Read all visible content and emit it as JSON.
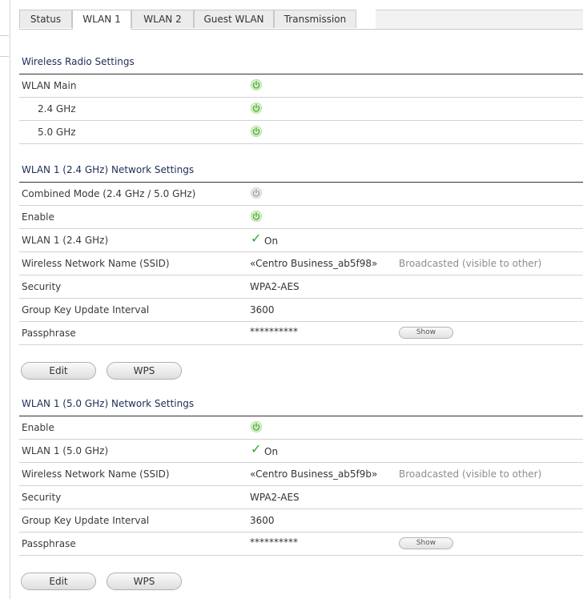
{
  "tabs": [
    {
      "label": "Status"
    },
    {
      "label": "WLAN 1"
    },
    {
      "label": "WLAN 2"
    },
    {
      "label": "Guest WLAN"
    },
    {
      "label": "Transmission"
    }
  ],
  "radio": {
    "title": "Wireless Radio Settings",
    "main": {
      "label": "WLAN Main",
      "state": "on"
    },
    "band24": {
      "label": "2.4 GHz",
      "state": "on"
    },
    "band50": {
      "label": "5.0 GHz",
      "state": "on"
    }
  },
  "wlan24": {
    "title": "WLAN 1 (2.4 GHz) Network Settings",
    "combined": {
      "label": "Combined Mode (2.4 GHz / 5.0 GHz)",
      "state": "off"
    },
    "enable": {
      "label": "Enable",
      "state": "on"
    },
    "status": {
      "label": "WLAN 1 (2.4 GHz)",
      "value": "On"
    },
    "ssid": {
      "label": "Wireless Network Name (SSID)",
      "value": "«Centro Business_ab5f98»",
      "note": "Broadcasted (visible to other)"
    },
    "security": {
      "label": "Security",
      "value": "WPA2-AES"
    },
    "interval": {
      "label": "Group Key Update Interval",
      "value": "3600"
    },
    "passphrase": {
      "label": "Passphrase",
      "value": "**********",
      "show_label": "Show"
    },
    "edit_label": "Edit",
    "wps_label": "WPS"
  },
  "wlan50": {
    "title": "WLAN 1 (5.0 GHz) Network Settings",
    "enable": {
      "label": "Enable",
      "state": "on"
    },
    "status": {
      "label": "WLAN 1 (5.0 GHz)",
      "value": "On"
    },
    "ssid": {
      "label": "Wireless Network Name (SSID)",
      "value": "«Centro Business_ab5f9b»",
      "note": "Broadcasted (visible to other)"
    },
    "security": {
      "label": "Security",
      "value": "WPA2-AES"
    },
    "interval": {
      "label": "Group Key Update Interval",
      "value": "3600"
    },
    "passphrase": {
      "label": "Passphrase",
      "value": "**********",
      "show_label": "Show"
    },
    "edit_label": "Edit",
    "wps_label": "WPS"
  },
  "colors": {
    "power_on": "#58b83f",
    "power_off": "#a8a8a8",
    "check": "#2fa833",
    "heading": "#1d2d55"
  }
}
